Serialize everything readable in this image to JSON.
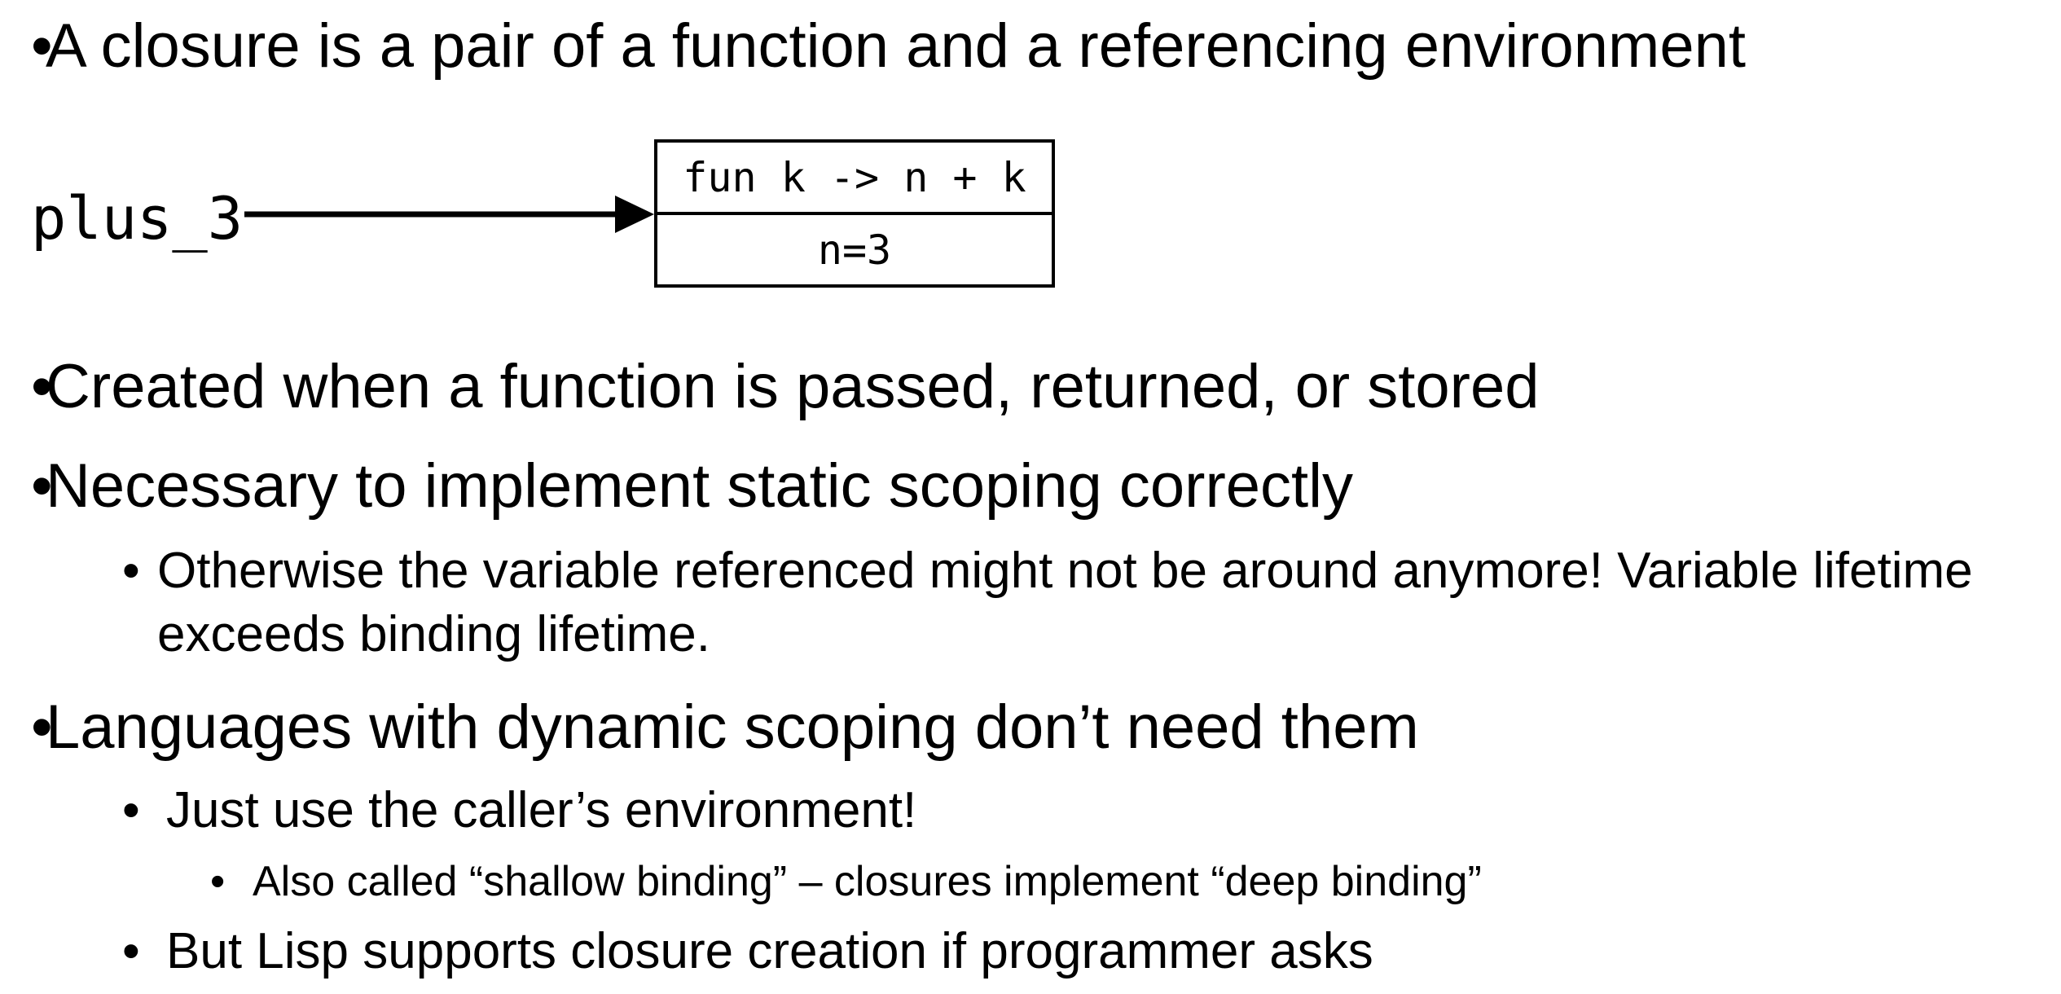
{
  "bullet_char": "•",
  "bullets": {
    "b1": "A closure is a pair of a function and a referencing environment",
    "b2": "Created when a function is passed, returned, or stored",
    "b3": "Necessary to implement static scoping correctly",
    "b3_1": "Otherwise the variable referenced might not be around anymore!  Variable lifetime exceeds binding lifetime.",
    "b4": "Languages with dynamic scoping don’t need them",
    "b4_1": "Just use the caller’s environment!",
    "b4_1_1": "Also called “shallow binding” – closures implement “deep binding”",
    "b4_2": "But Lisp supports closure creation if programmer asks"
  },
  "diagram": {
    "variable": "plus_3",
    "function": "fun k -> n + k",
    "environment": "n=3"
  }
}
